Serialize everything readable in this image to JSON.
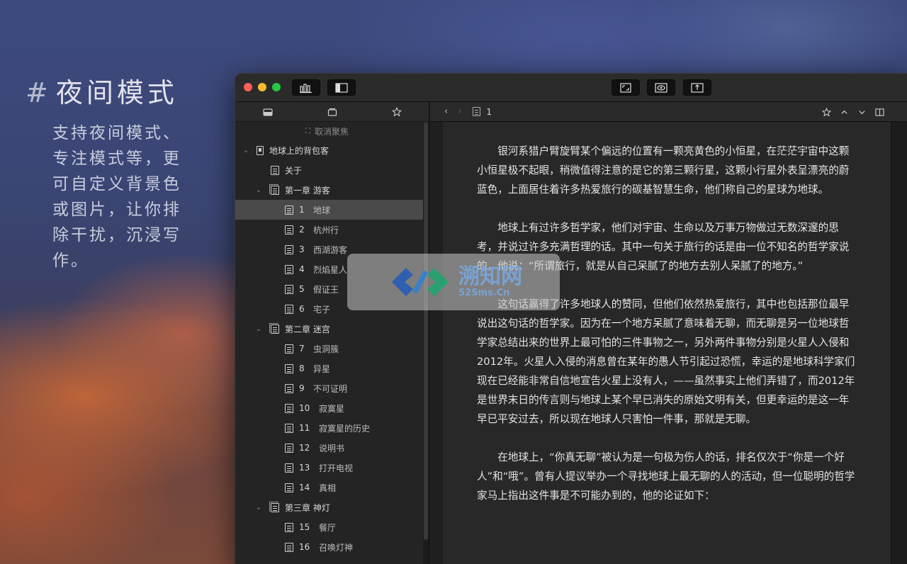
{
  "promo": {
    "hash": "#",
    "title": "夜间模式",
    "description": "支持夜间模式、专注模式等，更可自定义背景色或图片，让你排除干扰，沉浸写作。"
  },
  "toolbar": {
    "buttons": [
      "stats-icon",
      "sidebar-icon",
      "fullscreen-icon",
      "preview-icon",
      "share-icon"
    ]
  },
  "sidebar": {
    "tabs": [
      "inbox-icon",
      "stack-icon",
      "star-icon"
    ],
    "unfocus_label": "取消聚焦",
    "book": "地球上的背包客",
    "about": "关于",
    "chapters": [
      {
        "title": "第一章 游客",
        "items": [
          {
            "num": "1",
            "label": "地球"
          },
          {
            "num": "2",
            "label": "杭州行"
          },
          {
            "num": "3",
            "label": "西湖游客"
          },
          {
            "num": "4",
            "label": "烈焰星人"
          },
          {
            "num": "5",
            "label": "假证王"
          },
          {
            "num": "6",
            "label": "宅子"
          }
        ]
      },
      {
        "title": "第二章 迷宫",
        "items": [
          {
            "num": "7",
            "label": "虫洞簇"
          },
          {
            "num": "8",
            "label": "异星"
          },
          {
            "num": "9",
            "label": "不可证明"
          },
          {
            "num": "10",
            "label": "寂寞星"
          },
          {
            "num": "11",
            "label": "寂寞星的历史"
          },
          {
            "num": "12",
            "label": "说明书"
          },
          {
            "num": "13",
            "label": "打开电视"
          },
          {
            "num": "14",
            "label": "真相"
          }
        ]
      },
      {
        "title": "第三章 神灯",
        "items": [
          {
            "num": "15",
            "label": "餐厅"
          },
          {
            "num": "16",
            "label": "召唤灯神"
          }
        ]
      }
    ]
  },
  "editor": {
    "nav_back": "‹",
    "nav_forward": "›",
    "file_name": "1",
    "paragraphs": [
      "银河系猎户臂旋臂某个偏远的位置有一颗亮黄色的小恒星，在茫茫宇宙中这颗小恒星极不起眼，稍微值得注意的是它的第三颗行星，这颗小行星外表呈漂亮的蔚蓝色，上面居住着许多热爱旅行的碳基智慧生命，他们称自己的星球为地球。",
      "地球上有过许多哲学家，他们对宇宙、生命以及万事万物做过无数深邃的思考，并说过许多充满哲理的话。其中一句关于旅行的话是由一位不知名的哲学家说的，他说：“所谓旅行，就是从自己呆腻了的地方去别人呆腻了的地方。”",
      "这句话赢得了许多地球人的赞同，但他们依然热爱旅行，其中也包括那位最早说出这句话的哲学家。因为在一个地方呆腻了意味着无聊，而无聊是另一位地球哲学家总结出来的世界上最可怕的三件事物之一，另外两件事物分别是火星人入侵和2012年。火星人入侵的消息曾在某年的愚人节引起过恐慌，幸运的是地球科学家们现在已经能非常自信地宣告火星上没有人，——虽然事实上他们弄错了，而2012年是世界末日的传言则与地球上某个早已消失的原始文明有关，但更幸运的是这一年早已平安过去，所以现在地球人只害怕一件事，那就是无聊。",
      "在地球上，“你真无聊”被认为是一句极为伤人的话，排名仅次于“你是一个好人”和“哦”。曾有人提议举办一个寻找地球上最无聊的人的活动，但一位聪明的哲学家马上指出这件事是不可能办到的，他的论证如下："
    ]
  },
  "watermark": {
    "big": "溯知网",
    "small": "52Sms.Cn"
  }
}
